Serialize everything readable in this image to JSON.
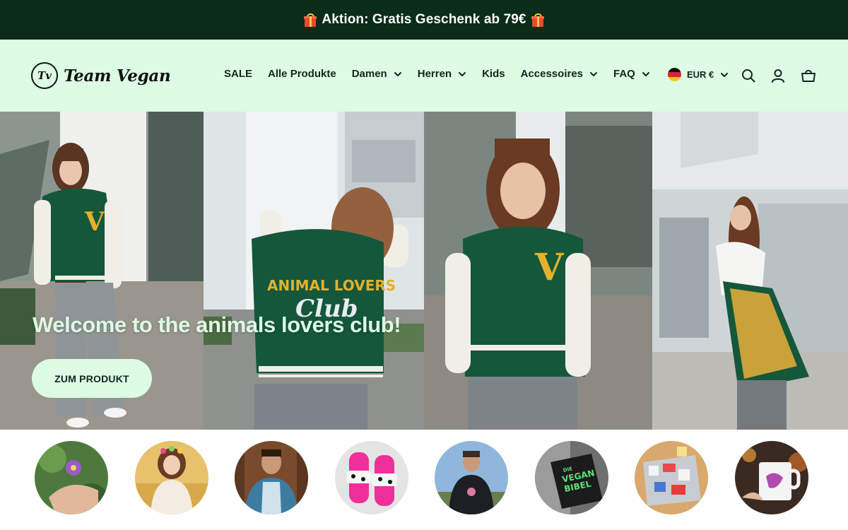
{
  "announcement": {
    "text": "Aktion: Gratis Geschenk ab 79€"
  },
  "brand": {
    "mark": "Tv",
    "name": "Team Vegan"
  },
  "nav": {
    "items": [
      {
        "label": "SALE",
        "has_dropdown": false
      },
      {
        "label": "Alle Produkte",
        "has_dropdown": false
      },
      {
        "label": "Damen",
        "has_dropdown": true
      },
      {
        "label": "Herren",
        "has_dropdown": true
      },
      {
        "label": "Kids",
        "has_dropdown": false
      },
      {
        "label": "Accessoires",
        "has_dropdown": true
      },
      {
        "label": "FAQ",
        "has_dropdown": true
      }
    ]
  },
  "locale": {
    "currency": "EUR €",
    "flag": "germany-flag-icon"
  },
  "header_icons": [
    "search-icon",
    "account-icon",
    "cart-icon"
  ],
  "hero": {
    "title": "Welcome to the animals lovers club!",
    "cta_label": "ZUM PRODUKT",
    "jacket_back_text": [
      "ANIMAL LOVERS",
      "Club"
    ]
  },
  "categories": {
    "count": 8,
    "book_text": [
      "DIE",
      "VEGAN",
      "BIBEL"
    ]
  },
  "colors": {
    "announcement_bg": "#0a2c18",
    "header_bg": "#dcfce4",
    "accent_mint": "#dcfce4",
    "text_dark": "#0b2a1a",
    "jacket_green": "#14573a",
    "jacket_letter": "#e3b12c"
  }
}
